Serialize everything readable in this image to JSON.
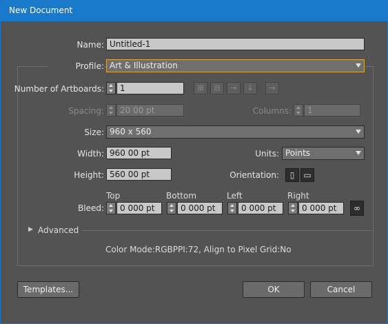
{
  "window": {
    "title": "New Document"
  },
  "name": {
    "label": "Name:",
    "value": "Untitled-1"
  },
  "profile": {
    "label": "Profile:",
    "value": "Art & Illustration"
  },
  "artboards": {
    "label": "Number of Artboards:",
    "value": "1"
  },
  "spacing": {
    "label": "Spacing:",
    "value": "20 00 pt"
  },
  "columns": {
    "label": "Columns:",
    "value": "1"
  },
  "size": {
    "label": "Size:",
    "value": "960 x 560"
  },
  "width": {
    "label": "Width:",
    "value": "960 00 pt"
  },
  "units": {
    "label": "Units:",
    "value": "Points"
  },
  "height": {
    "label": "Height:",
    "value": "560 00 pt"
  },
  "orientation": {
    "label": "Orientation:"
  },
  "bleed": {
    "label": "Bleed:",
    "top": {
      "label": "Top",
      "value": "0 000 pt"
    },
    "bottom": {
      "label": "Bottom",
      "value": "0 000 pt"
    },
    "left": {
      "label": "Left",
      "value": "0 000 pt"
    },
    "right": {
      "label": "Right",
      "value": "0 000 pt"
    }
  },
  "advanced": {
    "label": "Advanced"
  },
  "info": {
    "text": "Color Mode:RGBPPI:72, Align to Pixel Grid:No"
  },
  "buttons": {
    "templates": "Templates...",
    "ok": "OK",
    "cancel": "Cancel"
  },
  "icons": {
    "artboard_layout": [
      "grid-by-row-icon",
      "grid-by-column-icon",
      "arrange-by-row-icon",
      "arrange-by-column-icon",
      "right-to-left-icon"
    ],
    "orientation": [
      "portrait-icon",
      "landscape-icon"
    ],
    "bleed_link": "chain-link-icon"
  },
  "colors": {
    "titlebar": "#1979ca",
    "dialog_bg": "#535353",
    "focus_border": "#d7a640"
  }
}
